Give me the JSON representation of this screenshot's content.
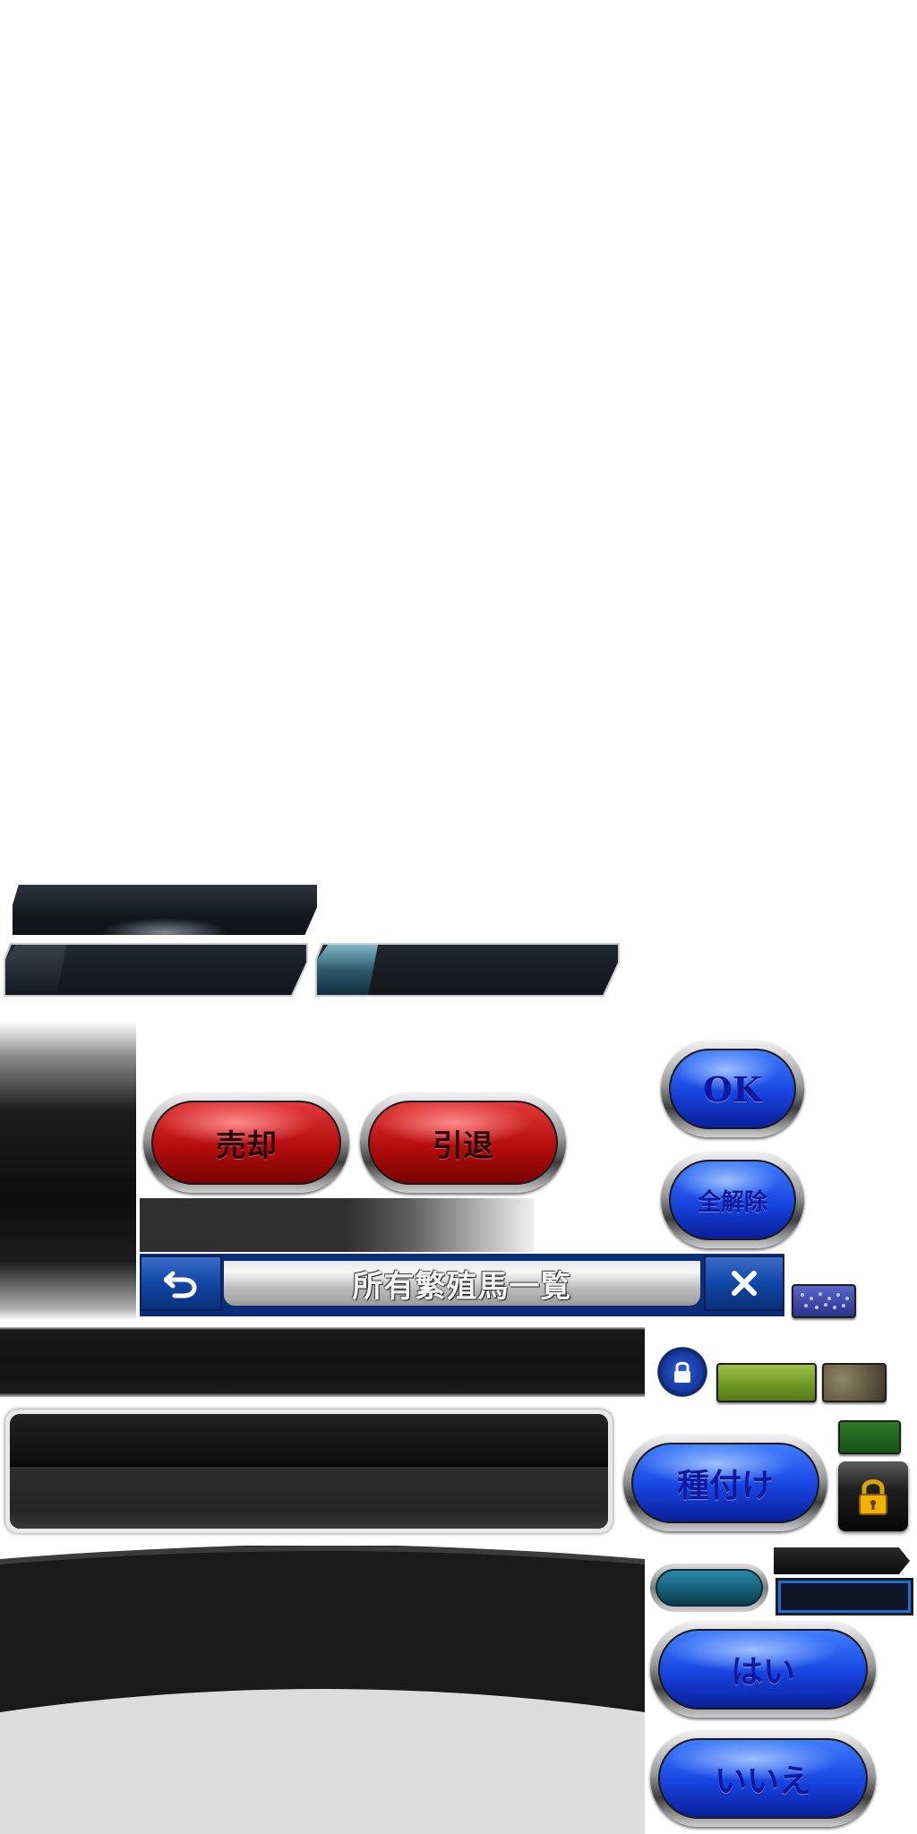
{
  "buttons": {
    "sell": "売却",
    "retire": "引退",
    "ok": "OK",
    "clear_all": "全解除",
    "breed": "種付け",
    "yes": "はい",
    "no": "いいえ"
  },
  "header": {
    "title": "所有繁殖馬一覧"
  },
  "icons": {
    "back": "back-arrow-icon",
    "close": "close-icon",
    "lock": "lock-icon",
    "padlock": "padlock-icon",
    "rain": "rain-icon"
  },
  "colors": {
    "red_button": "#c61414",
    "blue_button": "#1f4fe8",
    "header_blue": "#1147a8",
    "green_swatch": "#7aa428",
    "dark_green_swatch": "#1e5a1a",
    "teal_pill": "#1f6f8a"
  }
}
